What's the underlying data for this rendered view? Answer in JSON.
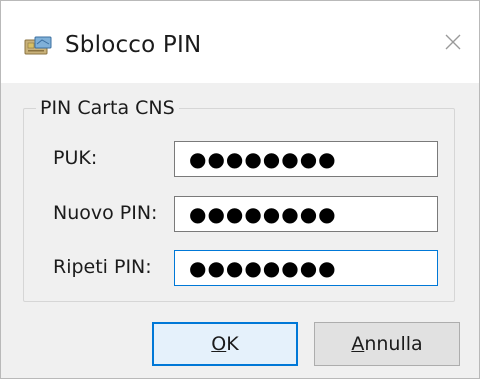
{
  "window": {
    "title": "Sblocco PIN",
    "app_icon": "pin-card-icon",
    "close_icon": "close-icon"
  },
  "group": {
    "legend": "PIN Carta CNS"
  },
  "fields": [
    {
      "label": "PUK:",
      "value": "●●●●●●●●",
      "focused": false
    },
    {
      "label": "Nuovo PIN:",
      "value": "●●●●●●●●",
      "focused": false
    },
    {
      "label": "Ripeti PIN:",
      "value": "●●●●●●●●",
      "focused": true
    }
  ],
  "buttons": {
    "ok": {
      "mnemonic": "O",
      "rest": "K"
    },
    "cancel": {
      "mnemonic": "A",
      "rest": "nnulla"
    }
  },
  "colors": {
    "accent": "#0078d7",
    "dialog_bg": "#f0f0f0"
  }
}
